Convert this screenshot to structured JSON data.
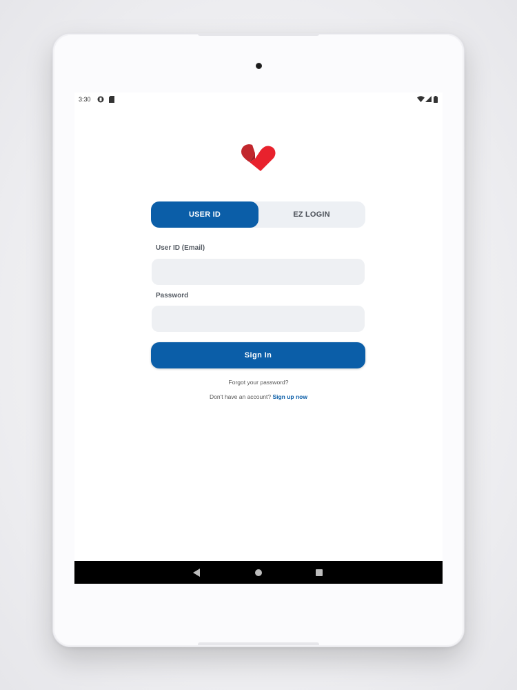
{
  "status_bar": {
    "time": "3:30",
    "icons": [
      "notification-icon",
      "sim-card-icon",
      "wifi-icon",
      "signal-icon",
      "battery-icon"
    ]
  },
  "brand": {
    "logo_icon": "heart-check-logo",
    "colors": {
      "primary": "#0b5ea8",
      "logo_red": "#e8222d",
      "logo_dark_red": "#c1272d"
    }
  },
  "login_mode_toggle": {
    "tabs": [
      {
        "label": "USER ID",
        "active": true
      },
      {
        "label": "EZ LOGIN",
        "active": false
      }
    ]
  },
  "form": {
    "user_id_label": "User ID (Email)",
    "user_id_value": "",
    "password_label": "Password",
    "password_value": "",
    "sign_in_label": "Sign In"
  },
  "links": {
    "forgot_password": "Forgot your password?",
    "no_account_text": "Don't have an account?",
    "sign_up": "Sign up now"
  },
  "nav_bar": {
    "icons": [
      "back-icon",
      "home-icon",
      "recents-icon"
    ]
  }
}
